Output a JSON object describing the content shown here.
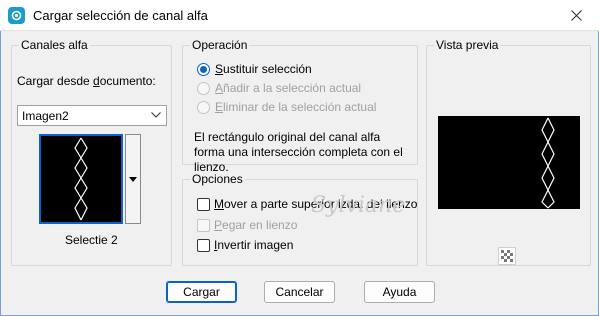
{
  "window": {
    "title": "Cargar selección de canal alfa"
  },
  "alpha_channels": {
    "legend": "Canales alfa",
    "load_label": "Cargar desde documento:",
    "load_label_pre": "Cargar desde ",
    "load_label_key": "d",
    "load_label_post": "ocumento:",
    "document_selected": "Imagen2",
    "channel_name": "Selectie 2"
  },
  "operation": {
    "legend": "Operación",
    "options": [
      {
        "key": "S",
        "rest": "ustituir selección",
        "checked": true,
        "enabled": true
      },
      {
        "key": "A",
        "rest": "ñadir a la selección actual",
        "checked": false,
        "enabled": false
      },
      {
        "key": "E",
        "rest": "liminar de la selección actual",
        "checked": false,
        "enabled": false
      }
    ],
    "description": "El rectángulo original del canal alfa forma una intersección completa con el lienzo."
  },
  "options": {
    "legend": "Opciones",
    "items": [
      {
        "key": "M",
        "rest": "over a parte superior izda. del lienzo",
        "checked": false,
        "enabled": true
      },
      {
        "key": "P",
        "rest": "egar en lienzo",
        "checked": false,
        "enabled": false
      },
      {
        "key": "I",
        "rest": "nvertir imagen",
        "checked": false,
        "enabled": true
      }
    ]
  },
  "preview": {
    "legend": "Vista previa"
  },
  "buttons": {
    "load": "Cargar",
    "cancel": "Cancelar",
    "help": "Ayuda"
  },
  "watermark": "Sylviane",
  "colors": {
    "accent": "#0a63c9",
    "title_icon": "#1a9ec9",
    "disabled_text": "#a0a0a0"
  },
  "icons": {
    "app": "paint-shop-icon",
    "close": "close-icon",
    "dropdown": "chevron-down-icon",
    "zoom": "checker-icon"
  }
}
